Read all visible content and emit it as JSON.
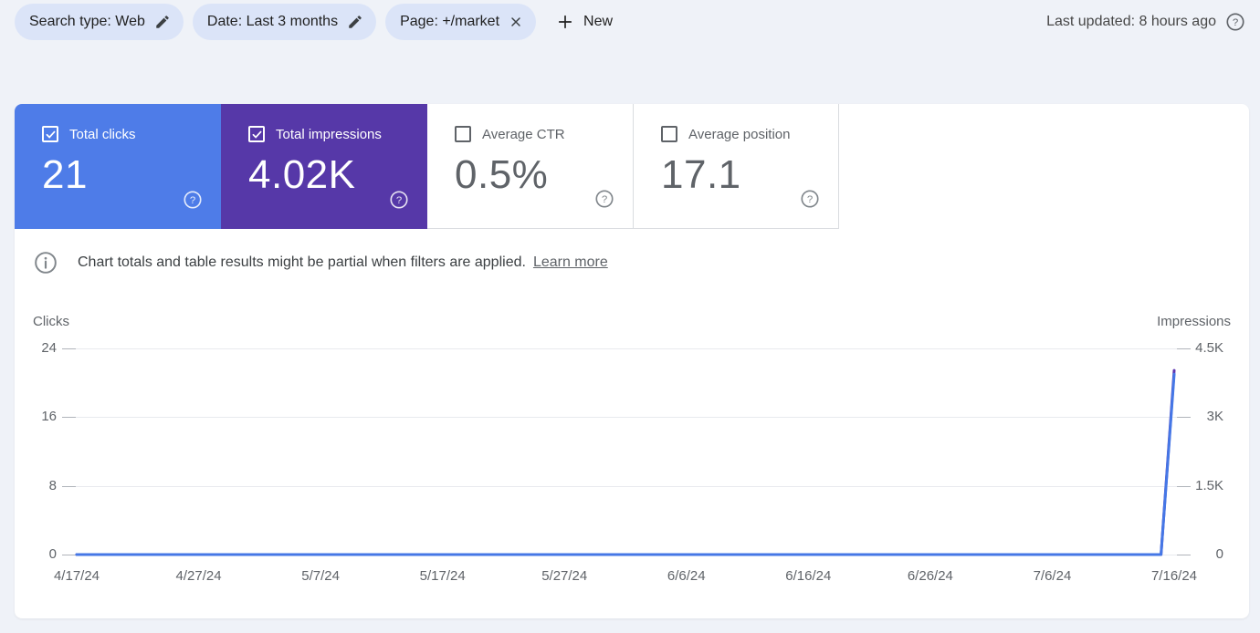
{
  "header": {
    "chips": [
      {
        "label": "Search type: Web",
        "icon": "edit"
      },
      {
        "label": "Date: Last 3 months",
        "icon": "edit"
      },
      {
        "label": "Page: +/market",
        "icon": "close"
      }
    ],
    "new_button": "New",
    "last_updated": "Last updated: 8 hours ago"
  },
  "metrics": [
    {
      "label": "Total clicks",
      "value": "21",
      "selected": true,
      "color": "#4e7ce8"
    },
    {
      "label": "Total impressions",
      "value": "4.02K",
      "selected": true,
      "color": "#5638a8"
    },
    {
      "label": "Average CTR",
      "value": "0.5%",
      "selected": false
    },
    {
      "label": "Average position",
      "value": "17.1",
      "selected": false
    }
  ],
  "notice": {
    "text": "Chart totals and table results might be partial when filters are applied.",
    "link": "Learn more"
  },
  "chart_data": {
    "type": "line",
    "dual_axis": true,
    "grid": "horizontal",
    "legend": "none",
    "left_axis": {
      "label": "Clicks",
      "ticks": [
        "24",
        "16",
        "8",
        "0"
      ],
      "max": 24
    },
    "right_axis": {
      "label": "Impressions",
      "ticks": [
        "4.5K",
        "3K",
        "1.5K",
        "0"
      ],
      "max": 4500
    },
    "x_ticks": [
      "4/17/24",
      "4/27/24",
      "5/7/24",
      "5/17/24",
      "5/27/24",
      "6/6/24",
      "6/16/24",
      "6/26/24",
      "7/6/24",
      "7/16/24"
    ],
    "x_fractions": [
      0,
      0.988,
      1
    ],
    "series": [
      {
        "name": "Impressions",
        "axis": "right",
        "color": "#5e35b1",
        "values": [
          0,
          0,
          4020
        ]
      },
      {
        "name": "Clicks",
        "axis": "left",
        "color": "#4577e6",
        "values": [
          0,
          0,
          21
        ]
      }
    ]
  }
}
